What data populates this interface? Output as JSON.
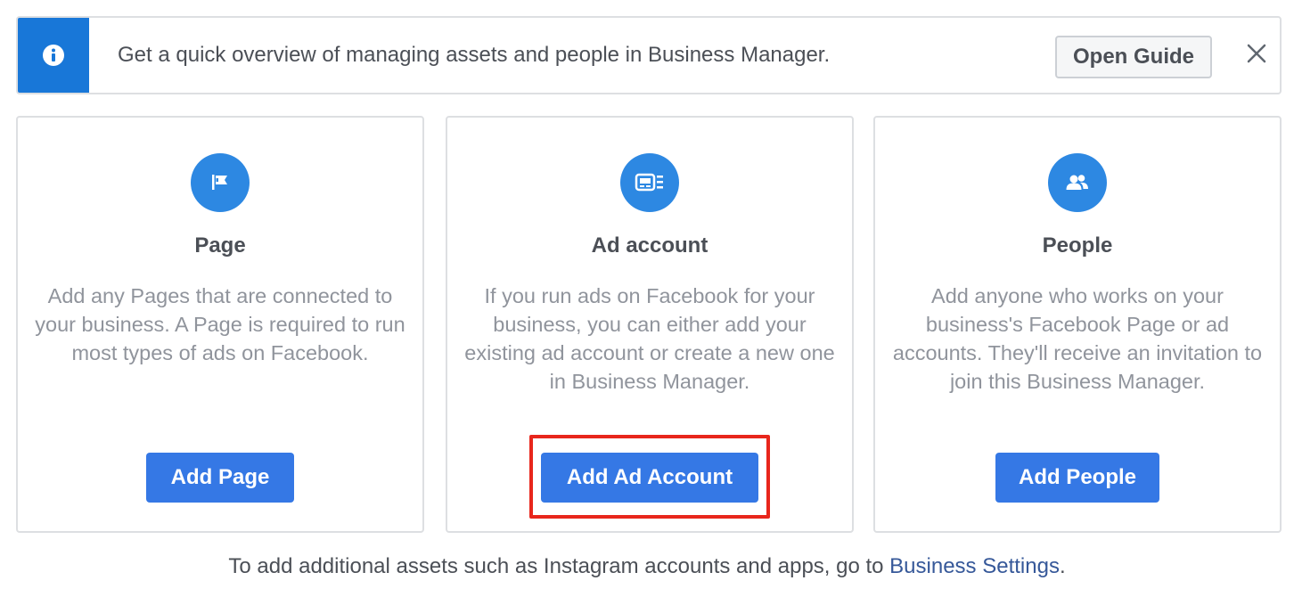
{
  "banner": {
    "icon": "info-icon",
    "text": "Get a quick overview of managing assets and people in Business Manager.",
    "guide_button": "Open Guide",
    "close_icon": "close-icon"
  },
  "cards": [
    {
      "icon": "flag-icon",
      "title": "Page",
      "description": "Add any Pages that are connected to your business. A Page is required to run most types of ads on Facebook.",
      "button": "Add Page"
    },
    {
      "icon": "ad-account-icon",
      "title": "Ad account",
      "description": "If you run ads on Facebook for your business, you can either add your existing ad account or create a new one in Business Manager.",
      "button": "Add Ad Account"
    },
    {
      "icon": "people-icon",
      "title": "People",
      "description": "Add anyone who works on your business's Facebook Page or ad accounts. They'll receive an invitation to join this Business Manager.",
      "button": "Add People"
    }
  ],
  "footer": {
    "text": "To add additional assets such as Instagram accounts and apps, go to ",
    "link": "Business Settings",
    "suffix": "."
  },
  "colors": {
    "primary_blue": "#3578e5",
    "banner_blue": "#1877d8",
    "highlight_red": "#e8261c"
  }
}
